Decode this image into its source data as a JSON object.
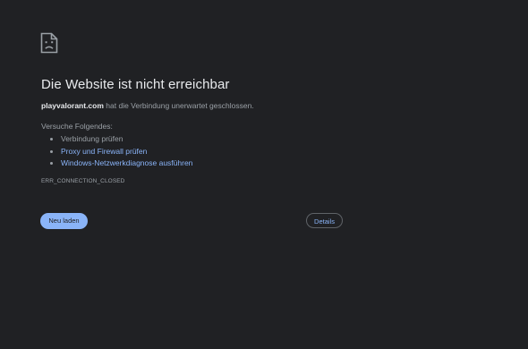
{
  "page": {
    "background": "#202124"
  },
  "icon": {
    "name": "sad-document-icon",
    "color": "#9aa0a6"
  },
  "error": {
    "title": "Die Website ist nicht erreichbar",
    "host": "playvalorant.com",
    "summary_rest": " hat die Verbindung unerwartet geschlossen.",
    "suggestions_heading": "Versuche Folgendes:",
    "suggestions": [
      {
        "label": "Verbindung prüfen",
        "is_link": false
      },
      {
        "label": "Proxy und Firewall prüfen",
        "is_link": true
      },
      {
        "label": "Windows-Netzwerkdiagnose ausführen",
        "is_link": true
      }
    ],
    "code": "ERR_CONNECTION_CLOSED"
  },
  "buttons": {
    "reload_label": "Neu laden",
    "details_label": "Details"
  },
  "colors": {
    "title": "#e8eaed",
    "text": "#9aa0a6",
    "link": "#8ab4f8",
    "primary_button": "#8ab4f8",
    "outline_border": "#5f6368"
  }
}
